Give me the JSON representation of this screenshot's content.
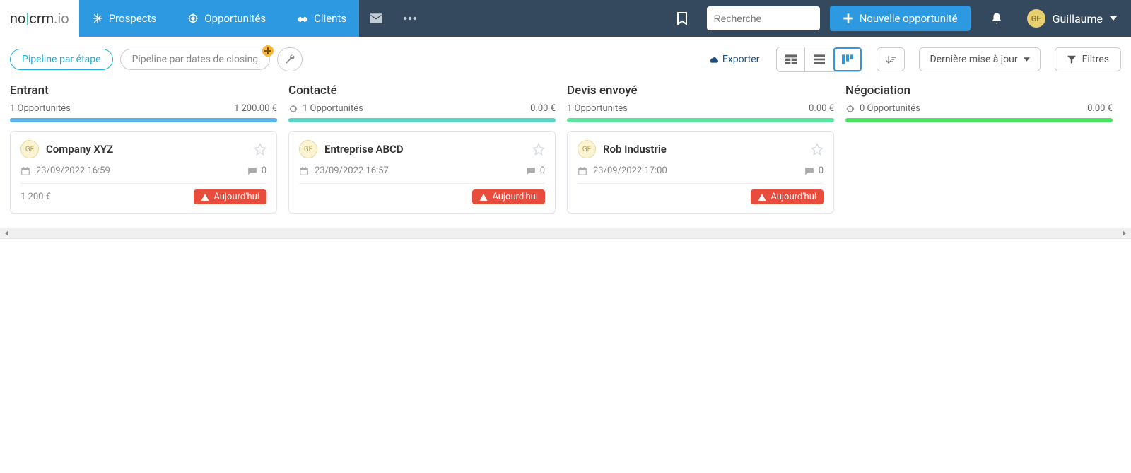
{
  "brand": {
    "p1": "no",
    "sep": "|",
    "p2": "crm",
    "dot": ".",
    "p3": "io"
  },
  "nav": {
    "prospects": "Prospects",
    "opportunites": "Opportunités",
    "clients": "Clients"
  },
  "search": {
    "placeholder": "Recherche"
  },
  "newBtn": "Nouvelle opportunité",
  "user": {
    "initials": "GF",
    "name": "Guillaume"
  },
  "toolbar": {
    "pill1": "Pipeline par étape",
    "pill2": "Pipeline par dates de closing",
    "export": "Exporter",
    "sortLabel": "Dernière mise à jour",
    "filters": "Filtres"
  },
  "columns": [
    {
      "title": "Entrant",
      "count": "1 Opportunités",
      "amount": "1 200.00 €",
      "barClass": "bar-blue",
      "showPlus": false,
      "cards": [
        {
          "owner": "GF",
          "title": "Company XYZ",
          "datetime": "23/09/2022 16:59",
          "comments": "0",
          "value": "1 200 €",
          "warn": "Aujourd'hui"
        }
      ]
    },
    {
      "title": "Contacté",
      "count": "1 Opportunités",
      "amount": "0.00 €",
      "barClass": "bar-teal",
      "showPlus": true,
      "cards": [
        {
          "owner": "GF",
          "title": "Entreprise ABCD",
          "datetime": "23/09/2022 16:57",
          "comments": "0",
          "value": "",
          "warn": "Aujourd'hui"
        }
      ]
    },
    {
      "title": "Devis envoyé",
      "count": "1 Opportunités",
      "amount": "0.00 €",
      "barClass": "bar-mint",
      "showPlus": false,
      "cards": [
        {
          "owner": "GF",
          "title": "Rob Industrie",
          "datetime": "23/09/2022 17:00",
          "comments": "0",
          "value": "",
          "warn": "Aujourd'hui"
        }
      ]
    },
    {
      "title": "Négociation",
      "count": "0 Opportunités",
      "amount": "0.00 €",
      "barClass": "bar-green",
      "showPlus": true,
      "cards": []
    }
  ]
}
